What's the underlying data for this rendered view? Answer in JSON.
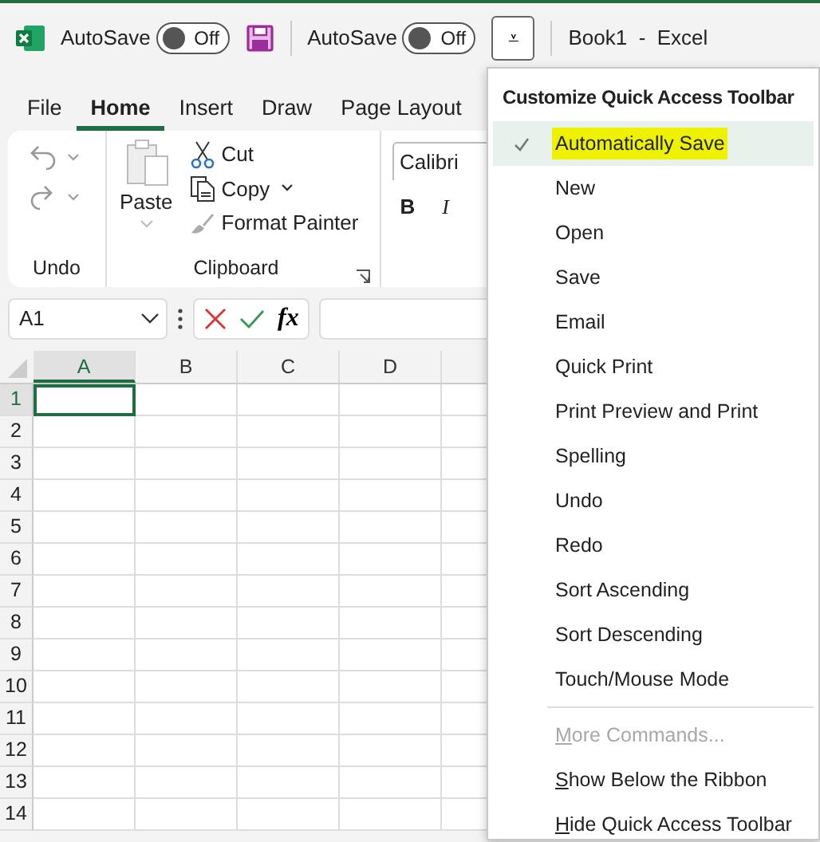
{
  "title_bar": {
    "autosave": [
      {
        "label": "AutoSave",
        "on": false,
        "state": "Off"
      },
      {
        "label": "AutoSave",
        "on": false,
        "state": "Off"
      }
    ],
    "customize_button": {
      "label": "⩡",
      "expanded": true
    },
    "title": "Book1  -  Excel"
  },
  "ribbon_tabs": [
    {
      "label": "File",
      "selected": false
    },
    {
      "label": "Home",
      "selected": true
    },
    {
      "label": "Insert",
      "selected": false
    },
    {
      "label": "Draw",
      "selected": false
    },
    {
      "label": "Page Layout",
      "selected": false
    }
  ],
  "ribbon": {
    "undo_group": {
      "label": "Undo",
      "disabled": true
    },
    "clipboard_group": {
      "label": "Clipboard",
      "paste": {
        "label": "Paste",
        "disabled": true
      },
      "cut": {
        "label": "Cut",
        "disabled": false
      },
      "copy": {
        "label": "Copy",
        "disabled": false
      },
      "format_painter": {
        "label": "Format Painter",
        "disabled": true
      }
    },
    "font_name": "Calibri",
    "bold": "B",
    "italic": "I"
  },
  "formula_bar": {
    "name_box": "A1",
    "function_button": "fx"
  },
  "grid": {
    "columns": [
      {
        "label": "A",
        "selected": true
      },
      {
        "label": "B",
        "selected": false
      },
      {
        "label": "C",
        "selected": false
      },
      {
        "label": "D",
        "selected": false
      }
    ],
    "rows": [
      {
        "label": "1",
        "selected": true
      },
      {
        "label": "2",
        "selected": false
      },
      {
        "label": "3",
        "selected": false
      },
      {
        "label": "4",
        "selected": false
      },
      {
        "label": "5",
        "selected": false
      },
      {
        "label": "6",
        "selected": false
      },
      {
        "label": "7",
        "selected": false
      },
      {
        "label": "8",
        "selected": false
      },
      {
        "label": "9",
        "selected": false
      },
      {
        "label": "10",
        "selected": false
      },
      {
        "label": "11",
        "selected": false
      },
      {
        "label": "12",
        "selected": false
      },
      {
        "label": "13",
        "selected": false
      },
      {
        "label": "14",
        "selected": false
      }
    ]
  },
  "menu": {
    "title": "Customize Quick Access Toolbar",
    "items": [
      {
        "kind": "command",
        "label": "Automatically Save",
        "checked": true,
        "selected": true,
        "marked": true
      },
      {
        "kind": "command",
        "label": "New",
        "checked": false,
        "selected": false
      },
      {
        "kind": "command",
        "label": "Open",
        "checked": false,
        "selected": false
      },
      {
        "kind": "command",
        "label": "Save",
        "checked": false,
        "selected": false
      },
      {
        "kind": "command",
        "label": "Email",
        "checked": false,
        "selected": false
      },
      {
        "kind": "command",
        "label": "Quick Print",
        "checked": false,
        "selected": false
      },
      {
        "kind": "command",
        "label": "Print Preview and Print",
        "checked": false,
        "selected": false
      },
      {
        "kind": "command",
        "label": "Spelling",
        "checked": false,
        "selected": false
      },
      {
        "kind": "command",
        "label": "Undo",
        "checked": false,
        "selected": false
      },
      {
        "kind": "command",
        "label": "Redo",
        "checked": false,
        "selected": false
      },
      {
        "kind": "command",
        "label": "Sort Ascending",
        "checked": false,
        "selected": false
      },
      {
        "kind": "command",
        "label": "Sort Descending",
        "checked": false,
        "selected": false
      },
      {
        "kind": "command",
        "label": "Touch/Mouse Mode",
        "checked": false,
        "selected": false
      },
      {
        "kind": "separator"
      },
      {
        "kind": "action",
        "label": "More Commands...",
        "disabled": true,
        "underline_first": true
      },
      {
        "kind": "action",
        "label": "Show Below the Ribbon",
        "disabled": false,
        "underline_first": true
      },
      {
        "kind": "action",
        "label": "Hide Quick Access Toolbar",
        "disabled": false,
        "underline_first": true
      }
    ]
  }
}
